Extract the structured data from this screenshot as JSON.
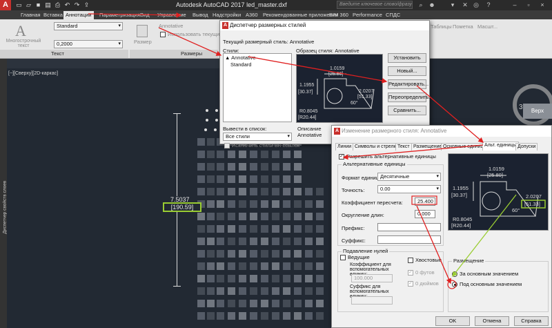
{
  "titlebar": {
    "app_title": "Autodesk AutoCAD 2017     led_master.dxf",
    "search_placeholder": "Введите ключевое слово/фразу"
  },
  "ribbon": {
    "tabs": [
      "Главная",
      "Вставка",
      "Аннотации",
      "Параметризация",
      "Вид",
      "Управление",
      "Вывод",
      "Надстройки",
      "A360",
      "Рекомендованные приложения",
      "BIM 360",
      "Performance",
      "СПДС"
    ],
    "active_tab": "Аннотации",
    "text_style": "Standard",
    "text_height": "0,2000",
    "multiline_text_label": "Многострочный текст",
    "dim_style": "Annotative",
    "use_current": "Использовать текущий",
    "size_label": "Размер",
    "panel_text": "Текст",
    "panel_dimensions": "Размеры",
    "right_labels": [
      "Таблицы",
      "Пометка",
      "Масшт..."
    ]
  },
  "workspace": {
    "viewport_label": "[−][Сверху][2D-каркас]",
    "left_strip_label": "Диспетчер свойств слоев",
    "dim_value": "7.5037",
    "dim_alt_value": "[190.59]",
    "cube_label": "Верх",
    "cube_number": "3"
  },
  "dialog_manager": {
    "title": "Диспетчер размерных стилей",
    "current_style": "Текущий размерный стиль: Annotative",
    "styles_label": "Стили:",
    "styles": [
      "Annotative",
      "Standard"
    ],
    "preview_label": "Образец стиля: Annotative",
    "buttons": [
      "Установить",
      "Новый...",
      "Редактировать...",
      "Переопределить...",
      "Сравнить..."
    ],
    "list_label": "Вывести в список:",
    "list_value": "Все стили",
    "exclude_xref": "Исключить стили Вн-ссылок",
    "description_label": "Описание",
    "description_value": "Annotative",
    "preview_values": [
      "1.0159",
      "[25.80]",
      "1.1955",
      "[30.37]",
      "2.0207",
      "[51.33]",
      "60°",
      "R0.8045",
      "[R20.44]"
    ]
  },
  "dialog_modify": {
    "title": "Изменение размерного стиля: Annotative",
    "tabs": [
      "Линии",
      "Символы и стрелки",
      "Текст",
      "Размещение",
      "Основные единицы",
      "Альт. единицы",
      "Допуски"
    ],
    "active_tab": "Альт. единицы",
    "enable_alt": "Разрешить альтернативные единицы",
    "alt_units_group": "Альтернативные единицы",
    "unit_format_label": "Формат единиц:",
    "unit_format_value": "Десятичные",
    "precision_label": "Точность:",
    "precision_value": "0.00",
    "multiplier_label": "Коэффициент пересчета:",
    "multiplier_value": "25.400",
    "round_label": "Округление длин:",
    "round_value": "0.000",
    "prefix_label": "Префикс:",
    "suffix_label": "Суффикс:",
    "zero_suppression_group": "Подавление нулей",
    "leading_label": "Ведущие",
    "sub_units_factor_label": "Коэффициент для вспомогательных единиц:",
    "sub_units_factor_value": "100.000",
    "sub_units_suffix_label": "Суффикс для вспомогательных единиц:",
    "trailing_label": "Хвостовые",
    "zero_feet_label": "0 футов",
    "zero_inches_label": "0 дюймов",
    "placement_group": "Размещение",
    "after_primary": "За основным значением",
    "below_primary": "Под основным значением",
    "ok": "OK",
    "cancel": "Отмена",
    "help": "Справка"
  }
}
